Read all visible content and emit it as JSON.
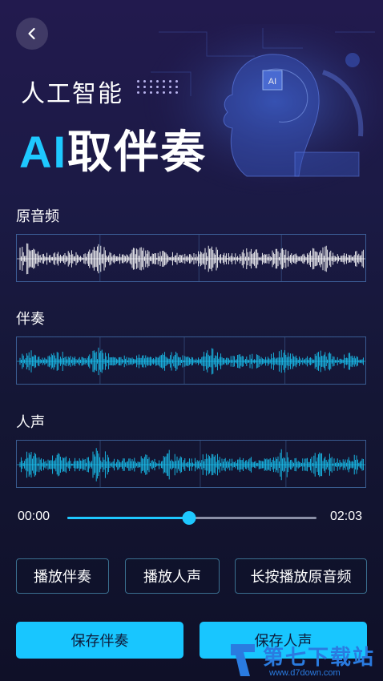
{
  "header": {
    "subtitle": "人工智能",
    "headline_ai": "AI",
    "headline_rest": "取伴奏",
    "hero_chip": "AI"
  },
  "tracks": [
    {
      "label": "原音频",
      "color": "#ffffff",
      "seed": 7,
      "density": 0.62
    },
    {
      "label": "伴奏",
      "color": "#19c2f0",
      "seed": 19,
      "density": 0.55
    },
    {
      "label": "人声",
      "color": "#19c2f0",
      "seed": 41,
      "density": 0.7
    }
  ],
  "player": {
    "current_time": "00:00",
    "total_time": "02:03",
    "progress": 0.49
  },
  "actions": {
    "play_accompaniment": "播放伴奏",
    "play_vocals": "播放人声",
    "hold_play_original": "长按播放原音频",
    "save_accompaniment": "保存伴奏",
    "save_vocals": "保存人声"
  },
  "watermark": {
    "title": "第七下载站",
    "url": "www.d7down.com"
  },
  "colors": {
    "accent": "#1ec8ff",
    "button_fill": "#18c6ff"
  }
}
